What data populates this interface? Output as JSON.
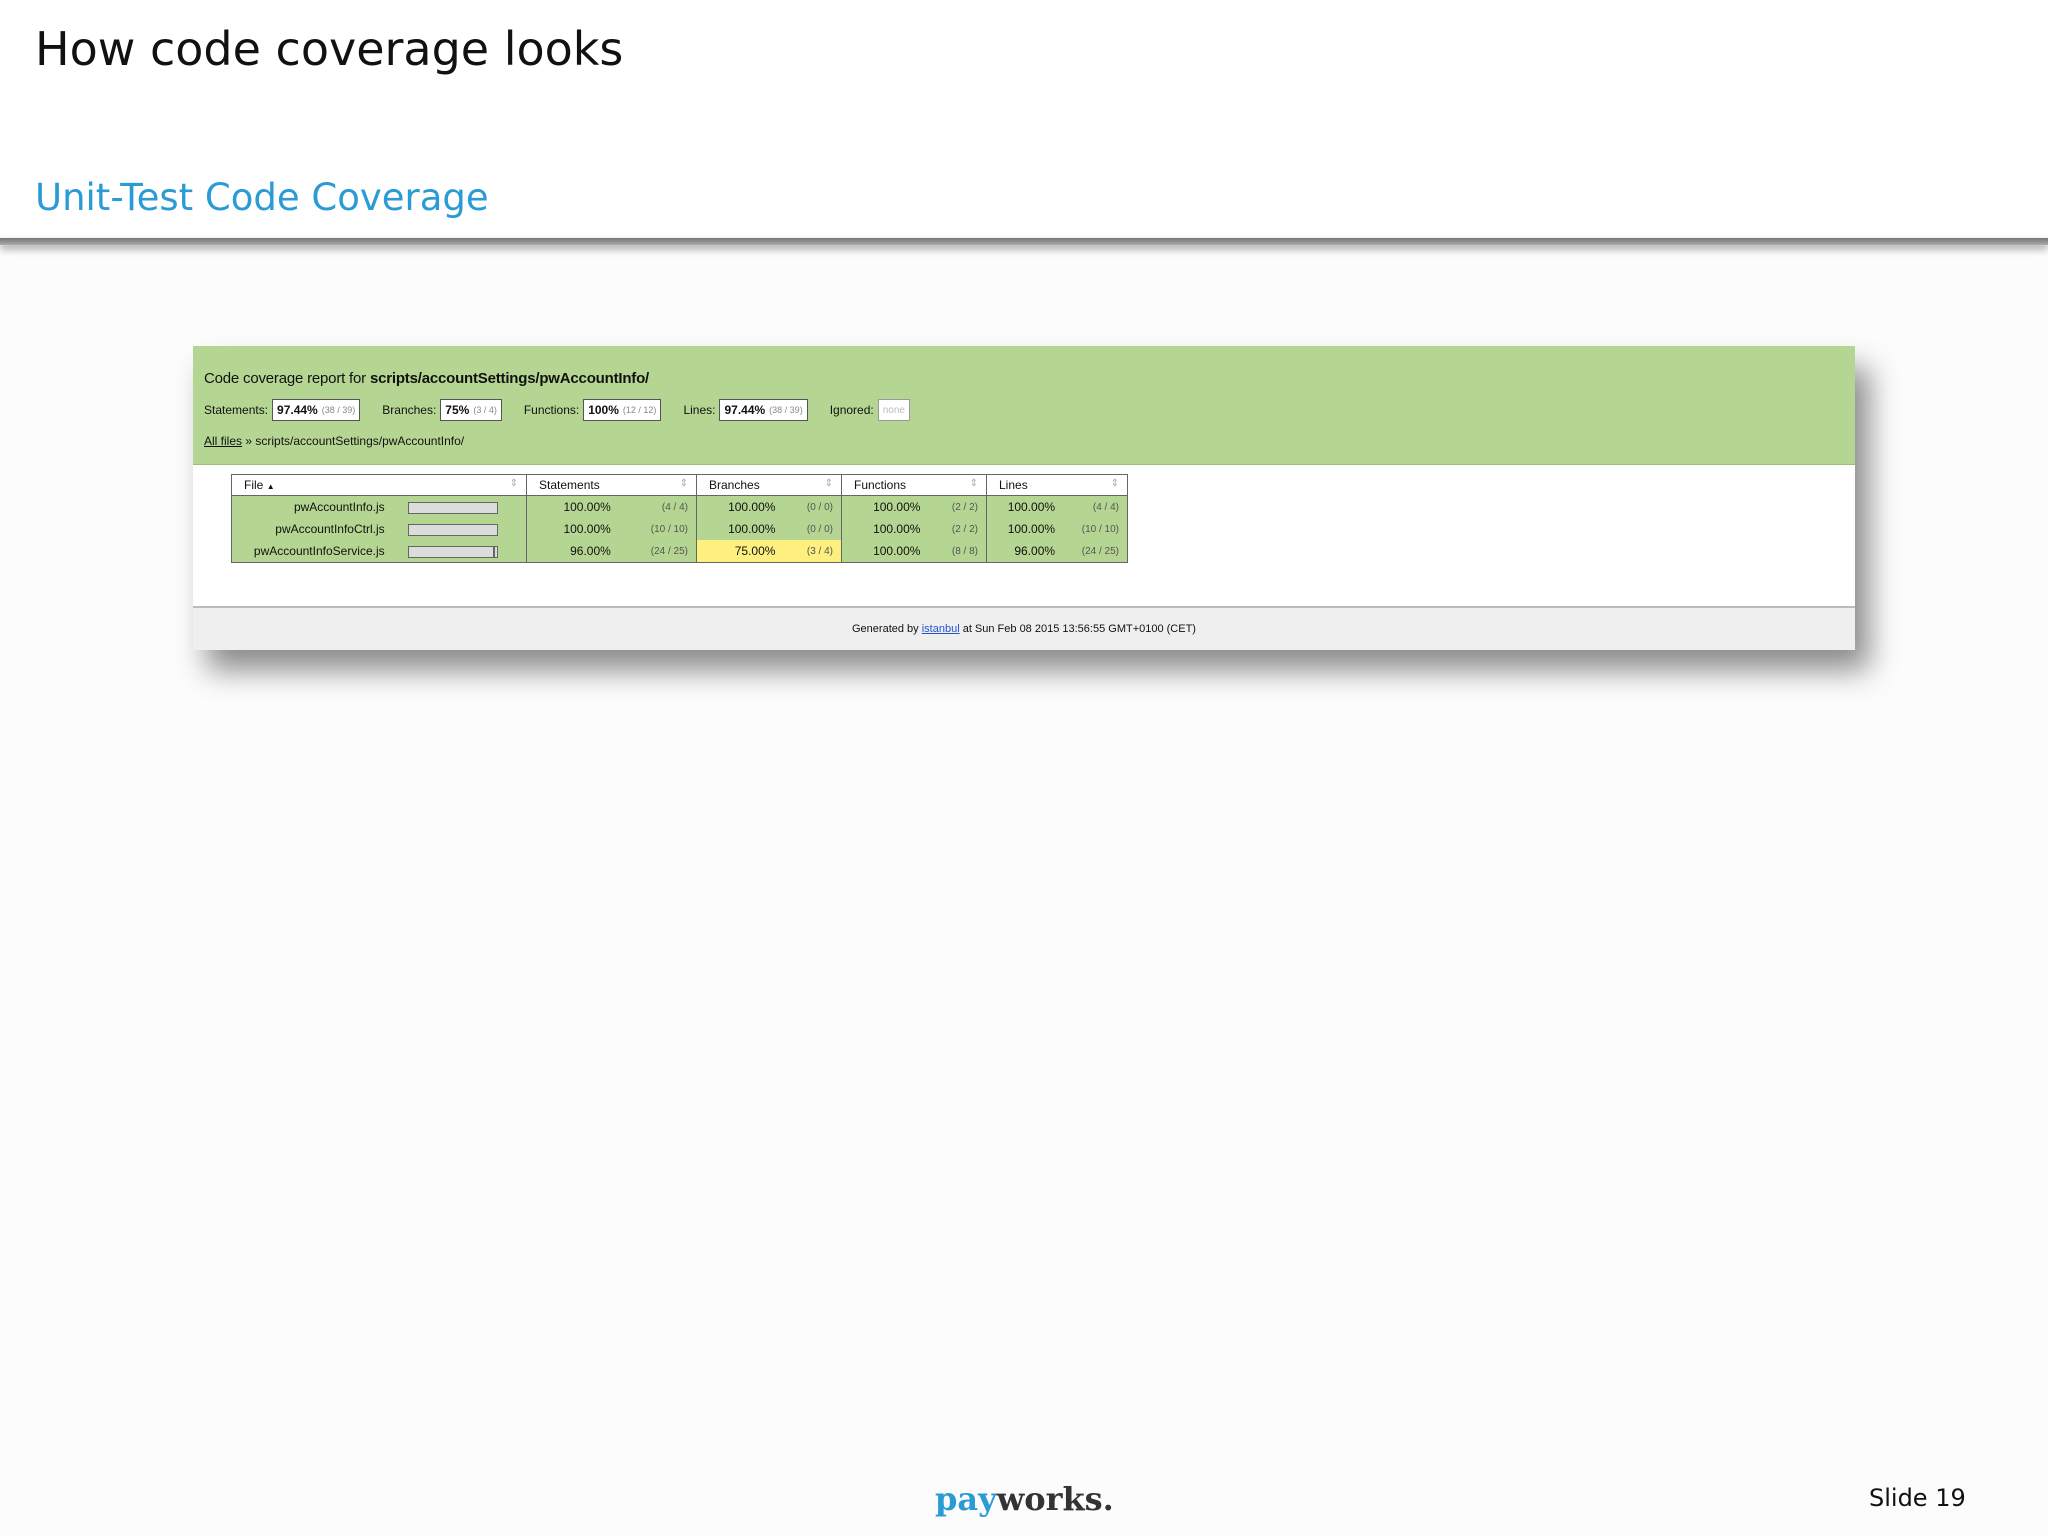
{
  "slide": {
    "title": "How code coverage looks",
    "subtitle": "Unit-Test Code Coverage",
    "number": "Slide 19",
    "logo_pay": "pay",
    "logo_works": "works."
  },
  "report": {
    "heading_prefix": "Code coverage report for ",
    "heading_path": "scripts/accountSettings/pwAccountInfo/",
    "summary": {
      "statements": {
        "label": "Statements:",
        "pct": "97.44%",
        "frac": "(38 / 39)"
      },
      "branches": {
        "label": "Branches:",
        "pct": "75%",
        "frac": "(3 / 4)"
      },
      "functions": {
        "label": "Functions:",
        "pct": "100%",
        "frac": "(12 / 12)"
      },
      "lines": {
        "label": "Lines:",
        "pct": "97.44%",
        "frac": "(38 / 39)"
      },
      "ignored": {
        "label": "Ignored:",
        "value": "none"
      }
    },
    "breadcrumb": {
      "all_files": "All files",
      "sep": " » ",
      "path": "scripts/accountSettings/pwAccountInfo/"
    },
    "columns": [
      "File",
      "Statements",
      "Branches",
      "Functions",
      "Lines"
    ],
    "file_sort_indicator": "▲",
    "rows": [
      {
        "file": "pwAccountInfo.js",
        "stmt_pct": "100.00%",
        "stmt_frac": "(4 / 4)",
        "br_pct": "100.00%",
        "br_frac": "(0 / 0)",
        "fn_pct": "100.00%",
        "fn_frac": "(2 / 2)",
        "ln_pct": "100.00%",
        "ln_frac": "(4 / 4)"
      },
      {
        "file": "pwAccountInfoCtrl.js",
        "stmt_pct": "100.00%",
        "stmt_frac": "(10 / 10)",
        "br_pct": "100.00%",
        "br_frac": "(0 / 0)",
        "fn_pct": "100.00%",
        "fn_frac": "(2 / 2)",
        "ln_pct": "100.00%",
        "ln_frac": "(10 / 10)"
      },
      {
        "file": "pwAccountInfoService.js",
        "stmt_pct": "96.00%",
        "stmt_frac": "(24 / 25)",
        "br_pct": "75.00%",
        "br_frac": "(3 / 4)",
        "fn_pct": "100.00%",
        "fn_frac": "(8 / 8)",
        "ln_pct": "96.00%",
        "ln_frac": "(24 / 25)"
      }
    ],
    "footer": {
      "prefix": "Generated by ",
      "link": "istanbul",
      "suffix": " at Sun Feb 08 2015 13:56:55 GMT+0100 (CET)"
    }
  }
}
